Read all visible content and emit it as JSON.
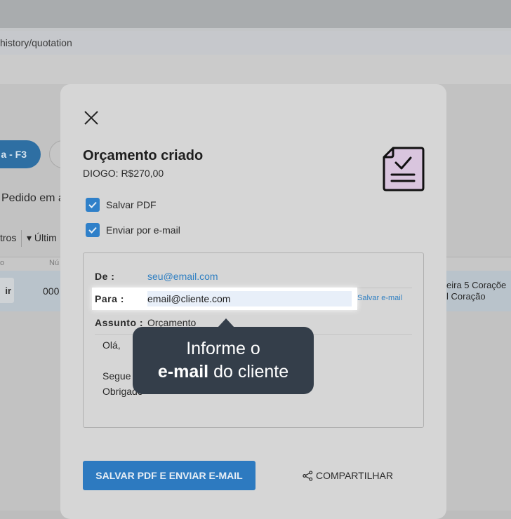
{
  "browser": {
    "url": "history/quotation"
  },
  "background": {
    "f3_button": "a - F3",
    "pedido_text": "Pedido em a",
    "filtros_text": "tros",
    "ultimos_text": "▾ Últim",
    "col1": "o",
    "col2": "Nú",
    "row_button": "ir",
    "row_number": "000",
    "row_right_line1": "eira 5 Coraçõe",
    "row_right_line2": "l Coração"
  },
  "modal": {
    "title": "Orçamento criado",
    "subtitle": "DIOGO: R$270,00",
    "checkboxes": [
      {
        "label": "Salvar PDF",
        "checked": true
      },
      {
        "label": "Enviar por e-mail",
        "checked": true
      }
    ],
    "email": {
      "from_label": "De :",
      "from_value": "seu@email.com",
      "to_label": "Para :",
      "to_value": "email@cliente.com",
      "save_email_link": "Salvar e-mail",
      "subject_label": "Assunto :",
      "subject_value": "Orçamento",
      "body_greeting": "Olá,",
      "body_line2": "Segue",
      "body_line3": "Obrigado"
    },
    "primary_button": "SALVAR PDF E ENVIAR E-MAIL",
    "share_button": "COMPARTILHAR"
  },
  "tooltip": {
    "line1": "Informe o",
    "line2_bold": "e-mail",
    "line2_rest": " do cliente"
  },
  "colors": {
    "accent": "#2f80c9",
    "tooltip_bg": "#343e4a",
    "icon_fill": "#d9c5de"
  }
}
